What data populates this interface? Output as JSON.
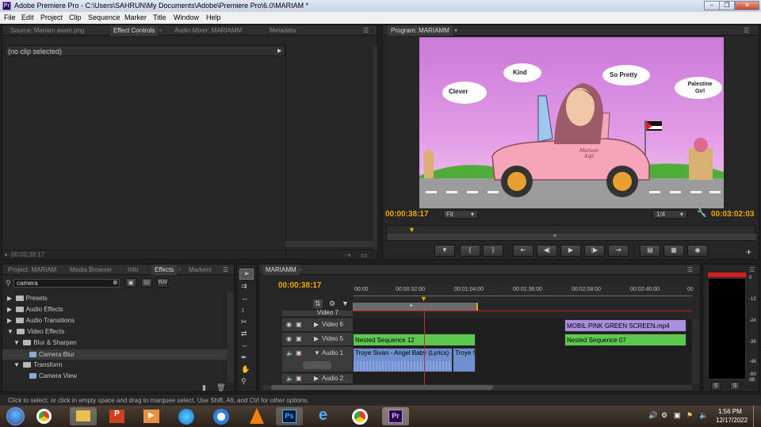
{
  "window": {
    "title": "Adobe Premiere Pro - C:\\Users\\SAHRUN\\My Documents\\Adobe\\Premiere Pro\\6.0\\MARIAM *",
    "app_icon": "Pr"
  },
  "menu": [
    "File",
    "Edit",
    "Project",
    "Clip",
    "Sequence",
    "Marker",
    "Title",
    "Window",
    "Help"
  ],
  "source_panel": {
    "tabs": [
      "Source: Mariam awan.png",
      "Effect Controls",
      "Audio Mixer: MARIAMM",
      "Metadata"
    ],
    "clip_text": "(no clip selected)",
    "timecode": "00:00:38:17"
  },
  "program": {
    "tab": "Program: MARIAMM",
    "timecode": "00:00:38:17",
    "fit": "Fit",
    "resolution": "1/4",
    "duration": "00:03:02:03",
    "video_labels": [
      "Kind",
      "Clever",
      "So Pretty",
      "Palestine Girl"
    ],
    "car_label": "Mariam Aqil"
  },
  "project_panel": {
    "tabs": [
      "Project: MARIAM",
      "Media Browser",
      "Info",
      "Effects",
      "Markers"
    ],
    "search": "camera",
    "items": [
      {
        "label": "Presets",
        "level": 0
      },
      {
        "label": "Audio Effects",
        "level": 0
      },
      {
        "label": "Audio Transitions",
        "level": 0
      },
      {
        "label": "Video Effects",
        "level": 0
      },
      {
        "label": "Blur & Sharpen",
        "level": 1
      },
      {
        "label": "Camera Blur",
        "level": 2
      },
      {
        "label": "Transform",
        "level": 1
      },
      {
        "label": "Camera View",
        "level": 2
      }
    ]
  },
  "timeline": {
    "tab": "MARIAMM",
    "timecode": "00:00:38:17",
    "ruler": [
      "00:00",
      "00:00:32:00",
      "00:01:04:00",
      "00:01:36:00",
      "00:02:08:00",
      "00:02:40:00",
      "00"
    ],
    "tracks": [
      "Video 7",
      "Video 6",
      "Video 5",
      "Audio 1",
      "Audio 2"
    ],
    "clips": {
      "v6": "MOBIL PINK GREEN SCREEN.mp4",
      "v5a": "Nested Sequence 12",
      "v5b": "Nested Sequence 07",
      "a1a": "Troye Sivan - Angel Baby (Lyrics)",
      "a1b": "Troye S"
    }
  },
  "meter": {
    "scale": [
      "0",
      "-12",
      "-24",
      "-36",
      "-48",
      "-60",
      "dB"
    ],
    "solo": [
      "S",
      "S"
    ]
  },
  "status": "Click to select, or click in empty space and drag to marquee select. Use Shift, Alt, and Ctrl for other options.",
  "taskbar": {
    "time": "1:56 PM",
    "date": "12/17/2022"
  },
  "colors": {
    "accent": "#f0a800",
    "clip_green": "#5cc850",
    "clip_purple": "#a98fe0",
    "clip_blue": "#6f8fcf",
    "playhead": "#f0a800"
  }
}
